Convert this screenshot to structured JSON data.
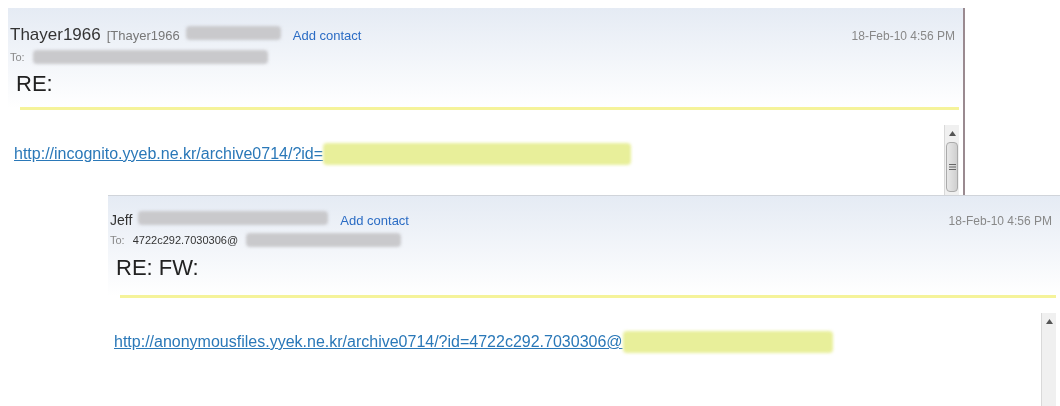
{
  "messages": [
    {
      "sender": "Thayer1966",
      "sender_address": "[Thayer1966",
      "add_contact": "Add contact",
      "to_label": "To:",
      "date": "18-Feb-10 4:56 PM",
      "subject": "RE:",
      "link": "http://incognito.yyeb.ne.kr/archive0714/?id="
    },
    {
      "sender": "Jeff",
      "add_contact": "Add contact",
      "to_label": "To:",
      "to_address": "4722c292.7030306@",
      "date": "18-Feb-10 4:56 PM",
      "subject": "RE: FW:",
      "link": "http://anonymousfiles.yyek.ne.kr/archive0714/?id=4722c292.7030306@"
    }
  ]
}
